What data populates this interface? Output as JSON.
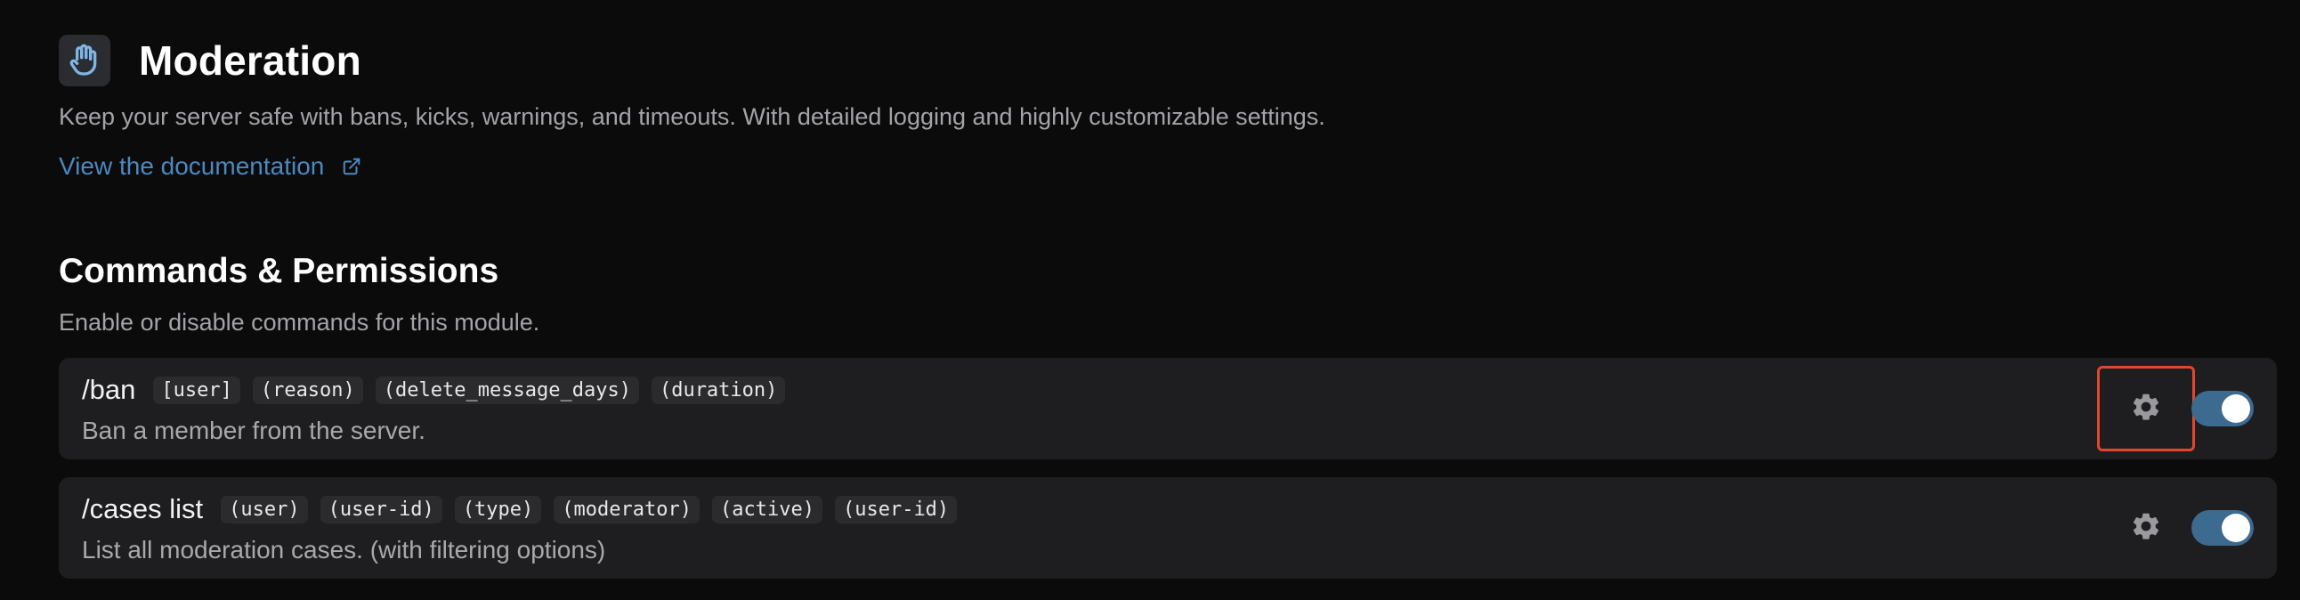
{
  "module": {
    "title": "Moderation",
    "description": "Keep your server safe with bans, kicks, warnings, and timeouts. With detailed logging and highly customizable settings.",
    "doc_link": "View the documentation",
    "icon": "raised-hand-icon"
  },
  "section": {
    "title": "Commands & Permissions",
    "description": "Enable or disable commands for this module."
  },
  "commands": [
    {
      "name": "/ban",
      "options": [
        "[user]",
        "(reason)",
        "(delete_message_days)",
        "(duration)"
      ],
      "description": "Ban a member from the server.",
      "enabled": true
    },
    {
      "name": "/cases list",
      "options": [
        "(user)",
        "(user-id)",
        "(type)",
        "(moderator)",
        "(active)",
        "(user-id)"
      ],
      "description": "List all moderation cases. (with filtering options)",
      "enabled": true
    }
  ],
  "colors": {
    "accent": "#4c88bf",
    "toggle_on": "#3d6a8f",
    "highlight": "#e2462f"
  }
}
